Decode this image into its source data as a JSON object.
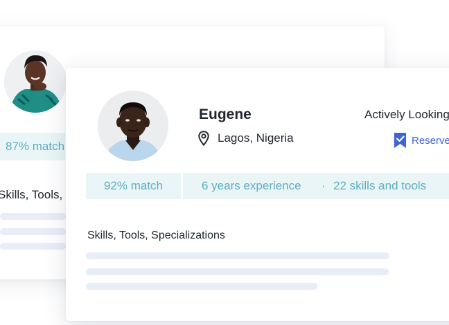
{
  "back_card": {
    "match": "87% match",
    "section_title": "Skills, Tools, Specializations"
  },
  "front_card": {
    "name": "Eugene",
    "location": "Lagos, Nigeria",
    "status": "Actively Looking",
    "reserve_label": "Reserve",
    "match": "92% match",
    "experience": "6 years experience",
    "separator": "·",
    "skills_count": "22 skills and tools",
    "section_title": "Skills, Tools, Specializations"
  },
  "colors": {
    "accent_teal": "#5eaebd",
    "tag_bg": "#eaf5f7",
    "reserve_blue": "#3f64d8",
    "placeholder_bar": "#e9edf7"
  },
  "icons": {
    "location": "map-pin-icon",
    "reserve": "bookmark-check-icon"
  }
}
